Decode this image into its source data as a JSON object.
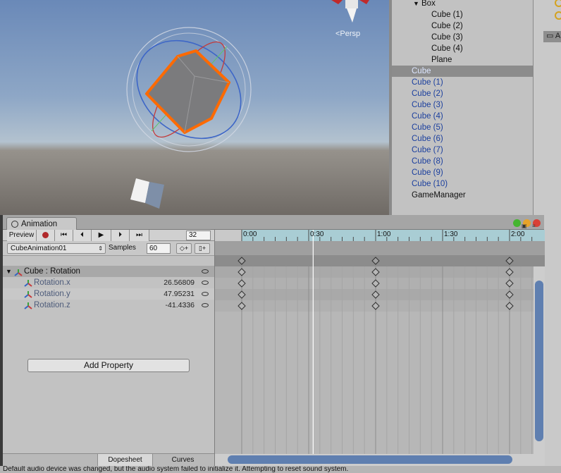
{
  "scene": {
    "projection_label": "<Persp"
  },
  "hierarchy": {
    "items": [
      {
        "label": "Box",
        "indent": 1,
        "style": "normal",
        "expanded": true
      },
      {
        "label": "Cube (1)",
        "indent": 2,
        "style": "normal"
      },
      {
        "label": "Cube (2)",
        "indent": 2,
        "style": "normal"
      },
      {
        "label": "Cube (3)",
        "indent": 2,
        "style": "normal"
      },
      {
        "label": "Cube (4)",
        "indent": 2,
        "style": "normal"
      },
      {
        "label": "Plane",
        "indent": 2,
        "style": "normal"
      },
      {
        "label": "Cube",
        "indent": 0,
        "style": "selected"
      },
      {
        "label": "Cube (1)",
        "indent": 0,
        "style": "blue"
      },
      {
        "label": "Cube (2)",
        "indent": 0,
        "style": "blue"
      },
      {
        "label": "Cube (3)",
        "indent": 0,
        "style": "blue"
      },
      {
        "label": "Cube (4)",
        "indent": 0,
        "style": "blue"
      },
      {
        "label": "Cube (5)",
        "indent": 0,
        "style": "blue"
      },
      {
        "label": "Cube (6)",
        "indent": 0,
        "style": "blue"
      },
      {
        "label": "Cube (7)",
        "indent": 0,
        "style": "blue"
      },
      {
        "label": "Cube (8)",
        "indent": 0,
        "style": "blue"
      },
      {
        "label": "Cube (9)",
        "indent": 0,
        "style": "blue"
      },
      {
        "label": "Cube (10)",
        "indent": 0,
        "style": "blue"
      },
      {
        "label": "GameManager",
        "indent": 0,
        "style": "normal"
      }
    ]
  },
  "project": {
    "folder_label": "A"
  },
  "animation": {
    "tab_title": "Animation",
    "preview_label": "Preview",
    "current_frame": "32",
    "clip_name": "CubeAnimation01",
    "samples_label": "Samples",
    "samples_value": "60",
    "add_keyframe_label": "◇+",
    "add_event_label": "▯+",
    "property_group": "Cube : Rotation",
    "properties": [
      {
        "name": "Rotation.x",
        "value": "26.56809"
      },
      {
        "name": "Rotation.y",
        "value": "47.95231"
      },
      {
        "name": "Rotation.z",
        "value": "-41.4336"
      }
    ],
    "add_property_label": "Add Property",
    "view_tabs": [
      "Dopesheet",
      "Curves"
    ],
    "active_view": "Dopesheet",
    "timeline_labels": [
      "0:00",
      "0:30",
      "1:00",
      "1:30",
      "2:00"
    ],
    "keyframe_times": [
      "0:00",
      "1:00",
      "2:00"
    ],
    "playhead_time": "0:32"
  },
  "status": {
    "message": "Default audio device was changed, but the audio system failed to initialize it. Attempting to reset sound system."
  },
  "colors": {
    "selection_orange": "#ff6a00",
    "hierarchy_blue": "#1b3f9e",
    "record_red": "#b0292b",
    "timeline_header": "#a9cdd4"
  }
}
